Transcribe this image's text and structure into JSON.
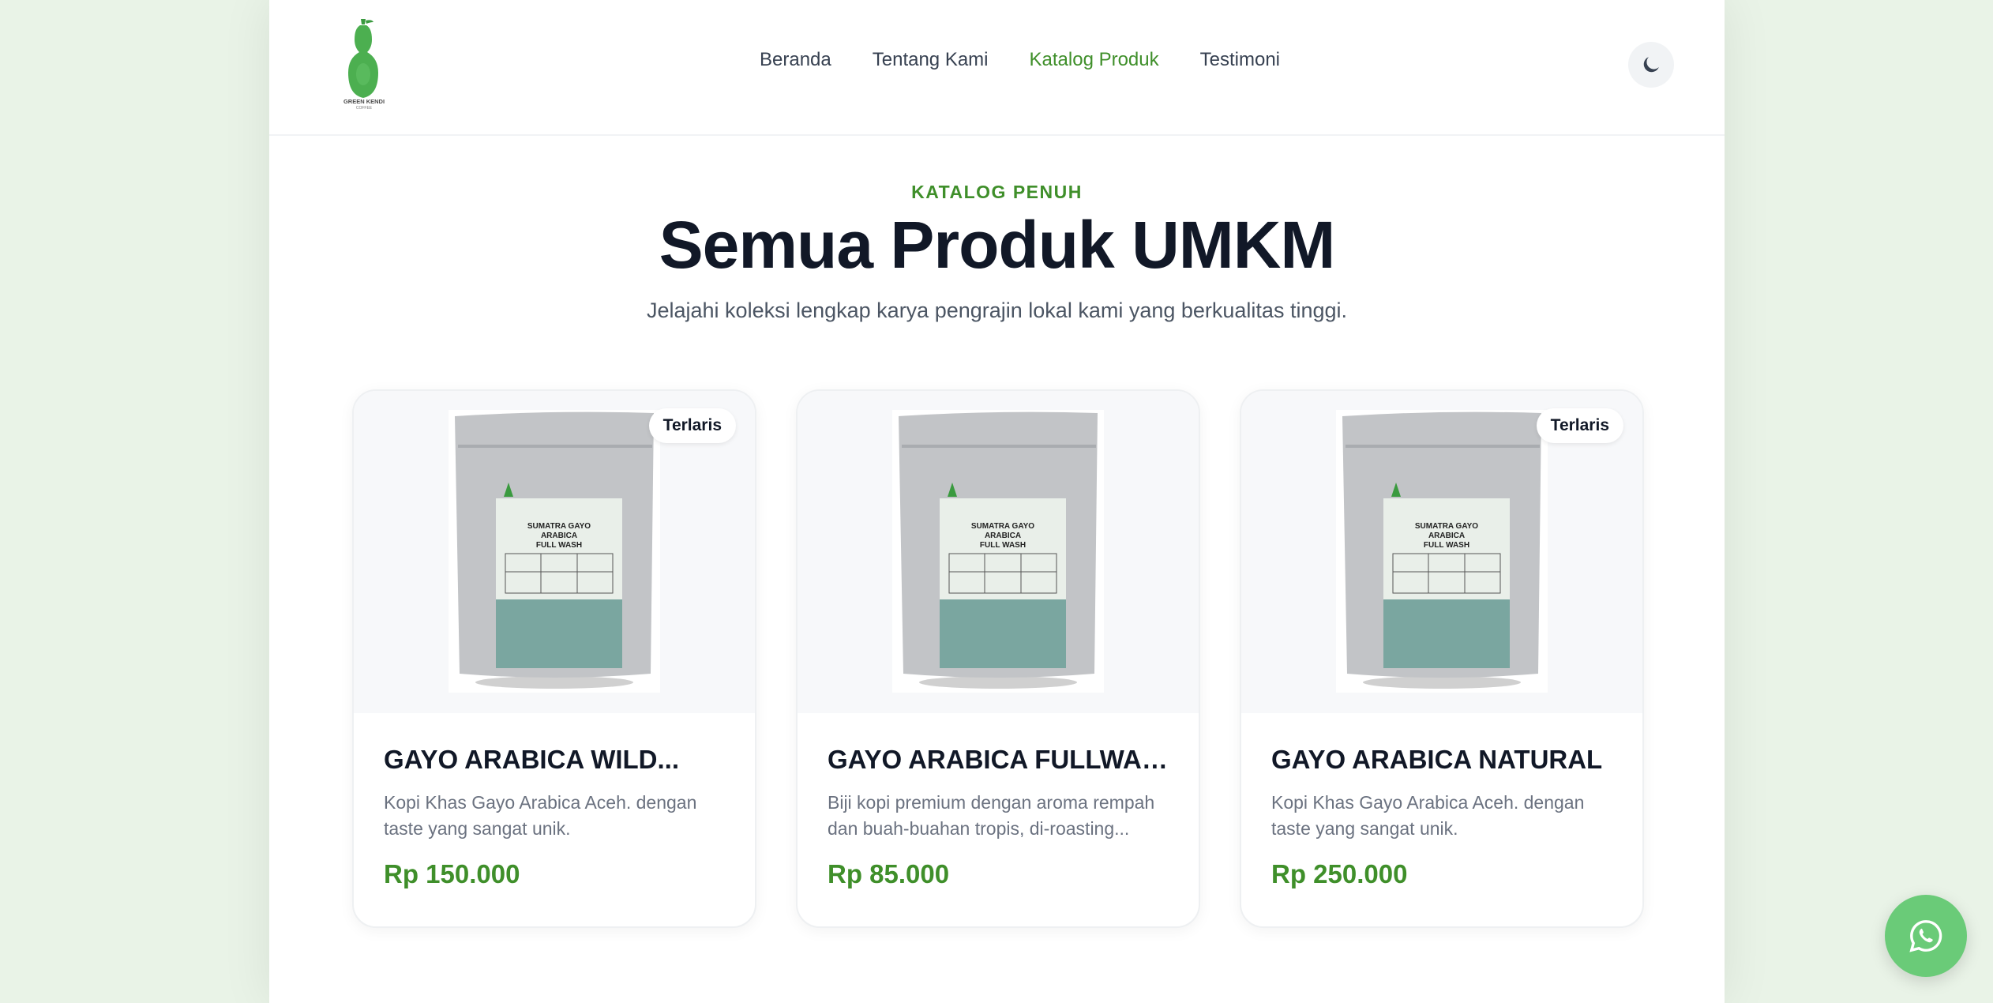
{
  "brand": {
    "logo_text": "GREEN KENDI",
    "logo_subtext": "COFFEE",
    "accent_color": "#3f8f2a"
  },
  "nav": {
    "items": [
      {
        "label": "Beranda",
        "active": false
      },
      {
        "label": "Tentang Kami",
        "active": false
      },
      {
        "label": "Katalog Produk",
        "active": true
      },
      {
        "label": "Testimoni",
        "active": false
      }
    ],
    "theme_toggle_icon": "moon-icon"
  },
  "hero": {
    "eyebrow": "KATALOG PENUH",
    "title": "Semua Produk UMKM",
    "subtitle": "Jelajahi koleksi lengkap karya pengrajin lokal kami yang berkualitas tinggi."
  },
  "products": [
    {
      "name": "GAYO ARABICA WILD...",
      "description": "Kopi Khas Gayo Arabica Aceh. dengan taste yang sangat unik.",
      "price": "Rp 150.000",
      "badge": "Terlaris",
      "package_label": "SUMATRA GAYO ARABICA FULL WASH"
    },
    {
      "name": "GAYO ARABICA FULLWASH",
      "description": "Biji kopi premium dengan aroma rempah dan buah-buahan tropis, di-roasting...",
      "price": "Rp 85.000",
      "badge": "",
      "package_label": "SUMATRA GAYO ARABICA FULL WASH"
    },
    {
      "name": "GAYO ARABICA NATURAL",
      "description": "Kopi Khas Gayo Arabica Aceh. dengan taste yang sangat unik.",
      "price": "Rp 250.000",
      "badge": "Terlaris",
      "package_label": "SUMATRA GAYO ARABICA FULL WASH"
    }
  ],
  "floating": {
    "whatsapp_icon": "whatsapp-icon",
    "whatsapp_color": "#6acb78"
  }
}
